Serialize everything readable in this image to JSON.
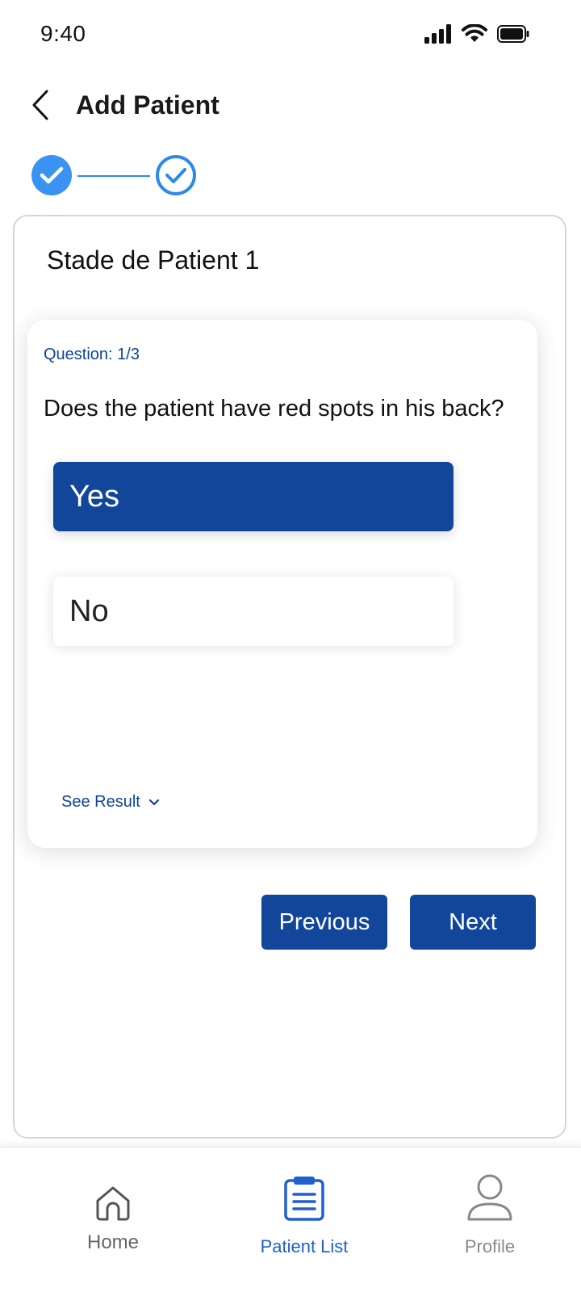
{
  "status_bar": {
    "time": "9:40"
  },
  "header": {
    "title": "Add Patient"
  },
  "stepper": {
    "steps": [
      "done",
      "current"
    ]
  },
  "card": {
    "title": "Stade de Patient 1"
  },
  "question": {
    "counter": "Question: 1/3",
    "text": "Does the patient have red spots in his back?",
    "options": [
      {
        "label": "Yes",
        "selected": true
      },
      {
        "label": "No",
        "selected": false
      }
    ],
    "see_result_label": "See Result"
  },
  "actions": {
    "previous_label": "Previous",
    "next_label": "Next"
  },
  "bottom_nav": {
    "items": [
      {
        "label": "Home",
        "icon": "home-icon",
        "active": false
      },
      {
        "label": "Patient List",
        "icon": "clipboard-icon",
        "active": true
      },
      {
        "label": "Profile",
        "icon": "user-icon",
        "active": false
      }
    ]
  },
  "colors": {
    "primary": "#11469a",
    "accent": "#2c8ae6",
    "step_done": "#3a93f2",
    "active_tab": "#1f5fd0"
  }
}
